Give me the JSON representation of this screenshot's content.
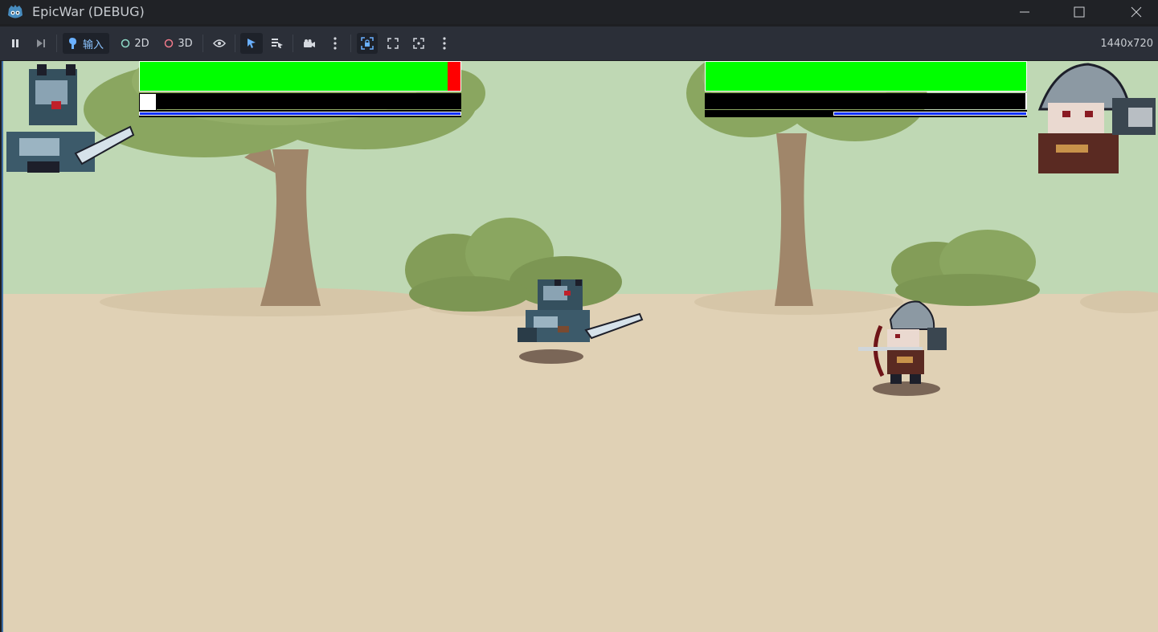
{
  "window": {
    "title": "EpicWar (DEBUG)",
    "icons": {
      "app": "godot-icon",
      "minimize": "minimize-icon",
      "maximize": "maximize-icon",
      "close": "close-icon"
    }
  },
  "toolbar": {
    "input_label": "输入",
    "mode_2d_label": "2D",
    "mode_3d_label": "3D",
    "resolution": "1440x720",
    "icons": [
      "pause-icon",
      "step-frame-icon",
      "input-icon",
      "view-icon",
      "select-tool-icon",
      "list-select-icon",
      "camera-icon",
      "more-icon",
      "frame-lock-icon",
      "fullscreen-icon",
      "expand-icon",
      "more-icon"
    ]
  },
  "hud": {
    "player1": {
      "health": 0.96,
      "energy": 0.05,
      "mana": 1.0
    },
    "player2": {
      "health": 1.0,
      "energy": 0.0,
      "mana": 0.6
    }
  },
  "colors": {
    "health": "#00ff00",
    "damage": "#ff0000",
    "energy_track": "#000000",
    "energy_fill": "#ffffff",
    "mana": "#1030ff",
    "sky": "#bfd8b4",
    "ground": "#e0d1b5",
    "tree_foliage": "#8aa660",
    "tree_trunk": "#a0866a"
  },
  "characters": [
    {
      "name": "wolf-knight",
      "role": "player1"
    },
    {
      "name": "helmeted-archer",
      "role": "player2"
    }
  ]
}
